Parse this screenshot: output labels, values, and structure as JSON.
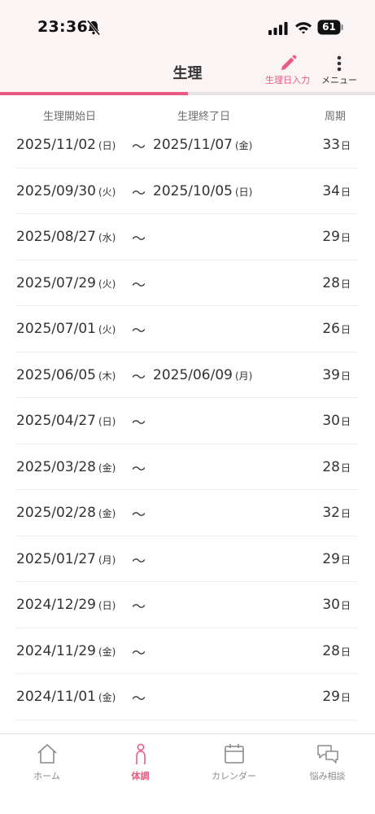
{
  "status_bar": {
    "time": "23:36",
    "battery": "61"
  },
  "header": {
    "title": "生理",
    "input_action_label": "生理日入力",
    "menu_action_label": "メニュー"
  },
  "columns": {
    "start": "生理開始日",
    "end": "生理終了日",
    "cycle": "周期"
  },
  "cycle_unit": "日",
  "tilde": "〜",
  "records": [
    {
      "start_date": "2025/11/02",
      "start_dow": "(日)",
      "end_date": "2025/11/07",
      "end_dow": "(金)",
      "cycle": "33"
    },
    {
      "start_date": "2025/09/30",
      "start_dow": "(火)",
      "end_date": "2025/10/05",
      "end_dow": "(日)",
      "cycle": "34"
    },
    {
      "start_date": "2025/08/27",
      "start_dow": "(水)",
      "end_date": "",
      "end_dow": "",
      "cycle": "29"
    },
    {
      "start_date": "2025/07/29",
      "start_dow": "(火)",
      "end_date": "",
      "end_dow": "",
      "cycle": "28"
    },
    {
      "start_date": "2025/07/01",
      "start_dow": "(火)",
      "end_date": "",
      "end_dow": "",
      "cycle": "26"
    },
    {
      "start_date": "2025/06/05",
      "start_dow": "(木)",
      "end_date": "2025/06/09",
      "end_dow": "(月)",
      "cycle": "39"
    },
    {
      "start_date": "2025/04/27",
      "start_dow": "(日)",
      "end_date": "",
      "end_dow": "",
      "cycle": "30"
    },
    {
      "start_date": "2025/03/28",
      "start_dow": "(金)",
      "end_date": "",
      "end_dow": "",
      "cycle": "28"
    },
    {
      "start_date": "2025/02/28",
      "start_dow": "(金)",
      "end_date": "",
      "end_dow": "",
      "cycle": "32"
    },
    {
      "start_date": "2025/01/27",
      "start_dow": "(月)",
      "end_date": "",
      "end_dow": "",
      "cycle": "29"
    },
    {
      "start_date": "2024/12/29",
      "start_dow": "(日)",
      "end_date": "",
      "end_dow": "",
      "cycle": "30"
    },
    {
      "start_date": "2024/11/29",
      "start_dow": "(金)",
      "end_date": "",
      "end_dow": "",
      "cycle": "28"
    },
    {
      "start_date": "2024/11/01",
      "start_dow": "(金)",
      "end_date": "",
      "end_dow": "",
      "cycle": "29"
    }
  ],
  "tabbar": {
    "home": "ホーム",
    "body": "体調",
    "calendar": "カレンダー",
    "consult": "悩み相談"
  },
  "colors": {
    "accent": "#ea5b83",
    "header_bg": "#fbf4f5"
  },
  "icons": {
    "edit": "pencil-icon",
    "menu": "more-vertical-icon",
    "home": "home-icon",
    "body": "person-icon",
    "calendar": "calendar-icon",
    "consult": "chat-bubbles-icon"
  }
}
